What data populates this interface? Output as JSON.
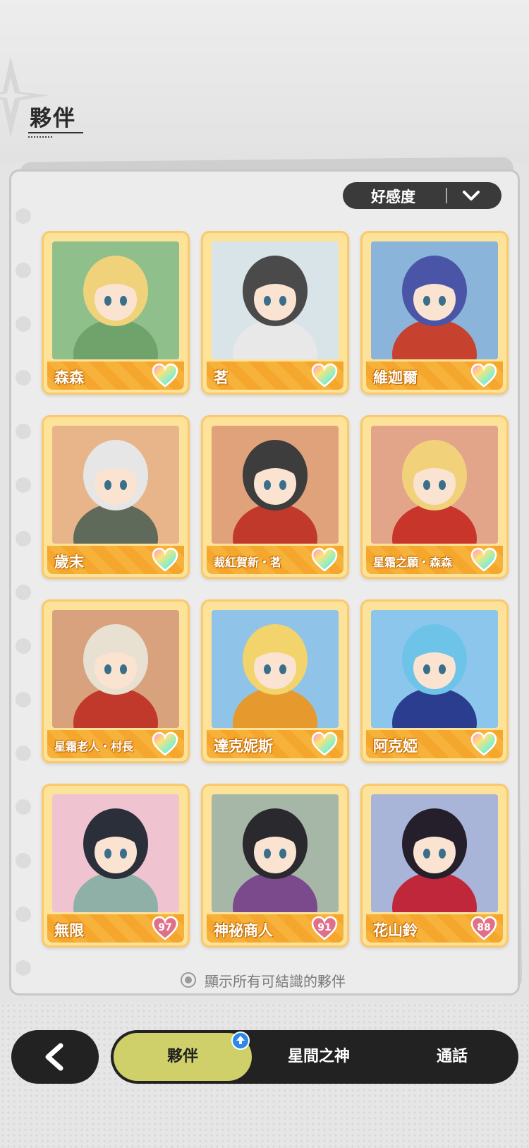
{
  "header": {
    "title": "夥伴"
  },
  "sort": {
    "label": "好感度"
  },
  "companions": [
    {
      "name": "森森",
      "affinity": "max",
      "colors": [
        "#8fbf8a",
        "#f0d27a",
        "#6fa36b"
      ]
    },
    {
      "name": "茗",
      "affinity": "max",
      "colors": [
        "#d9e4e8",
        "#4a4a4a",
        "#e8e8e8"
      ]
    },
    {
      "name": "維迦爾",
      "affinity": "max",
      "colors": [
        "#8ab4d9",
        "#4a55a8",
        "#c6412e"
      ]
    },
    {
      "name": "歲末",
      "affinity": "max",
      "colors": [
        "#e8b48a",
        "#e6e6e6",
        "#5f6a5a"
      ]
    },
    {
      "name": "裁紅賀新・茗",
      "affinity": "max",
      "colors": [
        "#e0a27a",
        "#3d3d3d",
        "#c0392b"
      ]
    },
    {
      "name": "星霜之願・森森",
      "affinity": "max",
      "colors": [
        "#e3a58a",
        "#f1d27a",
        "#c7352b"
      ]
    },
    {
      "name": "星霜老人・村長",
      "affinity": "max",
      "colors": [
        "#d8a27e",
        "#e8e0d0",
        "#c0392b"
      ]
    },
    {
      "name": "達克妮斯",
      "affinity": "max",
      "colors": [
        "#8fc3e8",
        "#f2d36c",
        "#e6992c"
      ]
    },
    {
      "name": "阿克婭",
      "affinity": "max",
      "colors": [
        "#8cc6ec",
        "#6ec4e8",
        "#2b3d8f"
      ]
    },
    {
      "name": "無限",
      "affinity": "97",
      "colors": [
        "#f0c3d0",
        "#2b2f3a",
        "#8fb0a6"
      ]
    },
    {
      "name": "神祕商人",
      "affinity": "91",
      "colors": [
        "#a7b7a7",
        "#2a2a2e",
        "#7a4a8c"
      ]
    },
    {
      "name": "花山鈴",
      "affinity": "88",
      "colors": [
        "#a8b4d8",
        "#241f2a",
        "#c0273a"
      ]
    }
  ],
  "show_all_label": "顯示所有可結識的夥伴",
  "tabs": [
    {
      "label": "夥伴",
      "active": true
    },
    {
      "label": "星間之神",
      "active": false
    },
    {
      "label": "通話",
      "active": false
    }
  ]
}
